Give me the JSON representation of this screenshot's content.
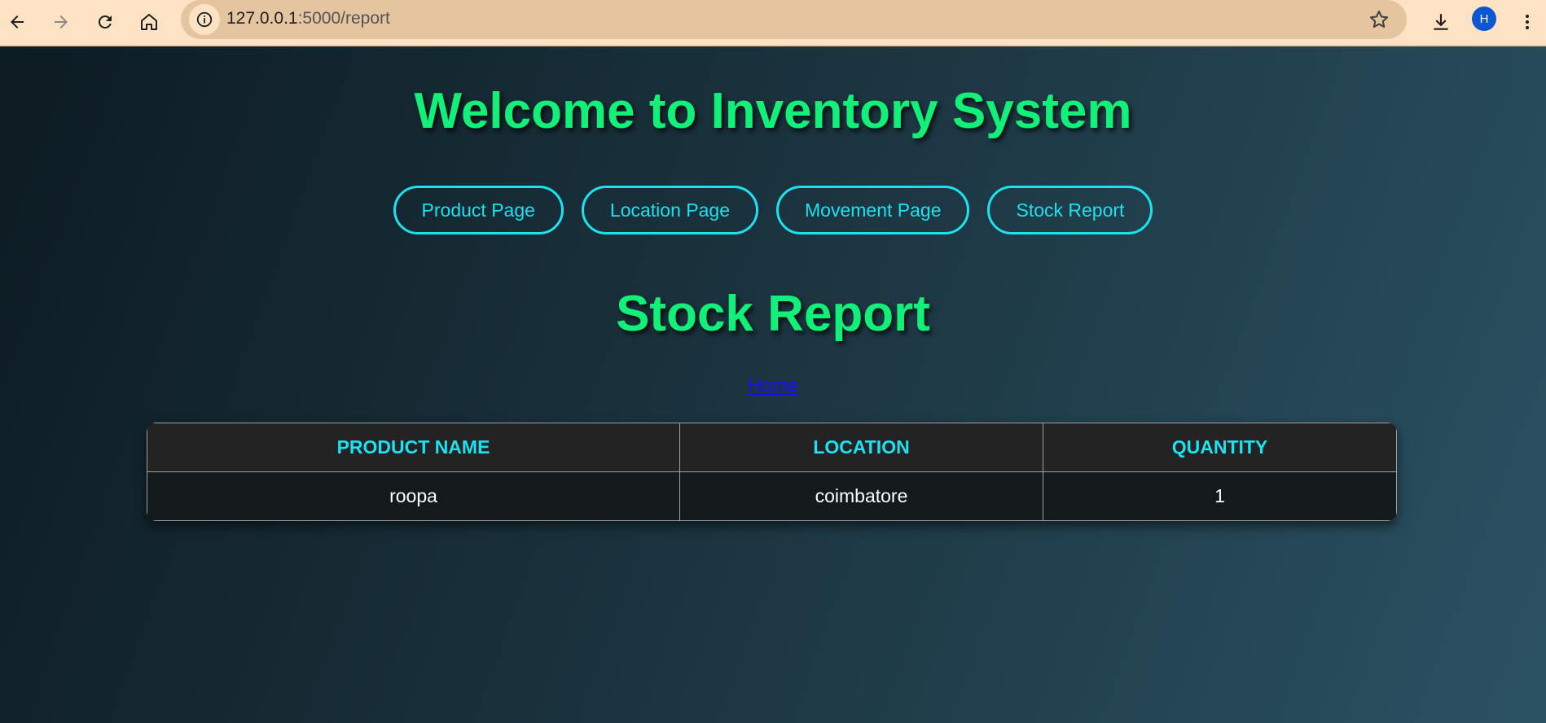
{
  "browser": {
    "url_host": "127.0.0.1",
    "url_path": ":5000/report",
    "avatar_initial": "H"
  },
  "page": {
    "title": "Welcome to Inventory System",
    "nav": [
      {
        "label": "Product Page"
      },
      {
        "label": "Location Page"
      },
      {
        "label": "Movement Page"
      },
      {
        "label": "Stock Report"
      }
    ],
    "section_title": "Stock Report",
    "home_link": "Home"
  },
  "table": {
    "headers": [
      "Product Name",
      "Location",
      "Quantity"
    ],
    "rows": [
      [
        "roopa",
        "coimbatore",
        "1"
      ]
    ]
  }
}
